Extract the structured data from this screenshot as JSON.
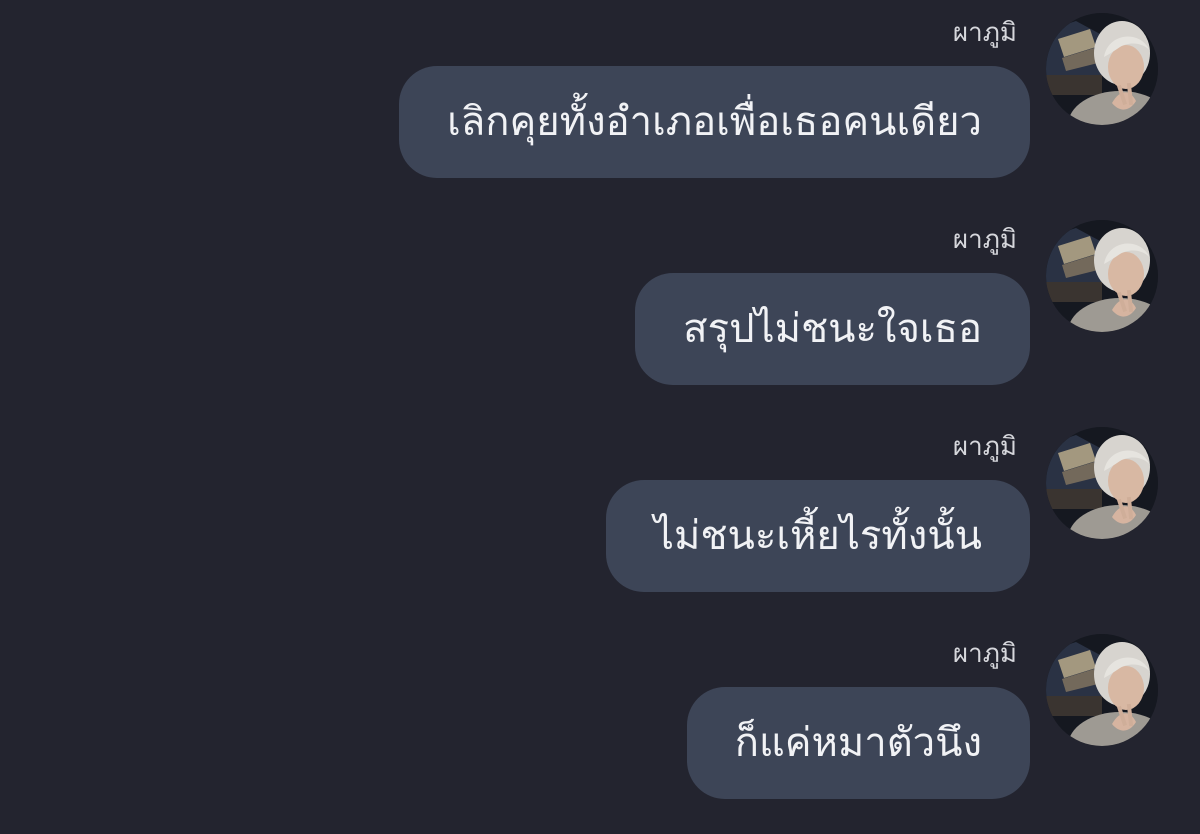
{
  "chat": {
    "messages": [
      {
        "sender": "ผาภูมิ",
        "text": "เลิกคุยทั้งอำเภอเพื่อเธอคนเดียว"
      },
      {
        "sender": "ผาภูมิ",
        "text": "สรุปไม่ชนะใจเธอ"
      },
      {
        "sender": "ผาภูมิ",
        "text": "ไม่ชนะเหี้ยไรทั้งนั้น"
      },
      {
        "sender": "ผาภูมิ",
        "text": "ก็แค่หมาตัวนึง"
      }
    ]
  },
  "colors": {
    "background": "#23242f",
    "bubble": "#3d4557",
    "bubble_text": "#f1f2f5",
    "sender_name": "#d6d7dc"
  },
  "icons": {
    "avatar": "avatar-photo"
  }
}
